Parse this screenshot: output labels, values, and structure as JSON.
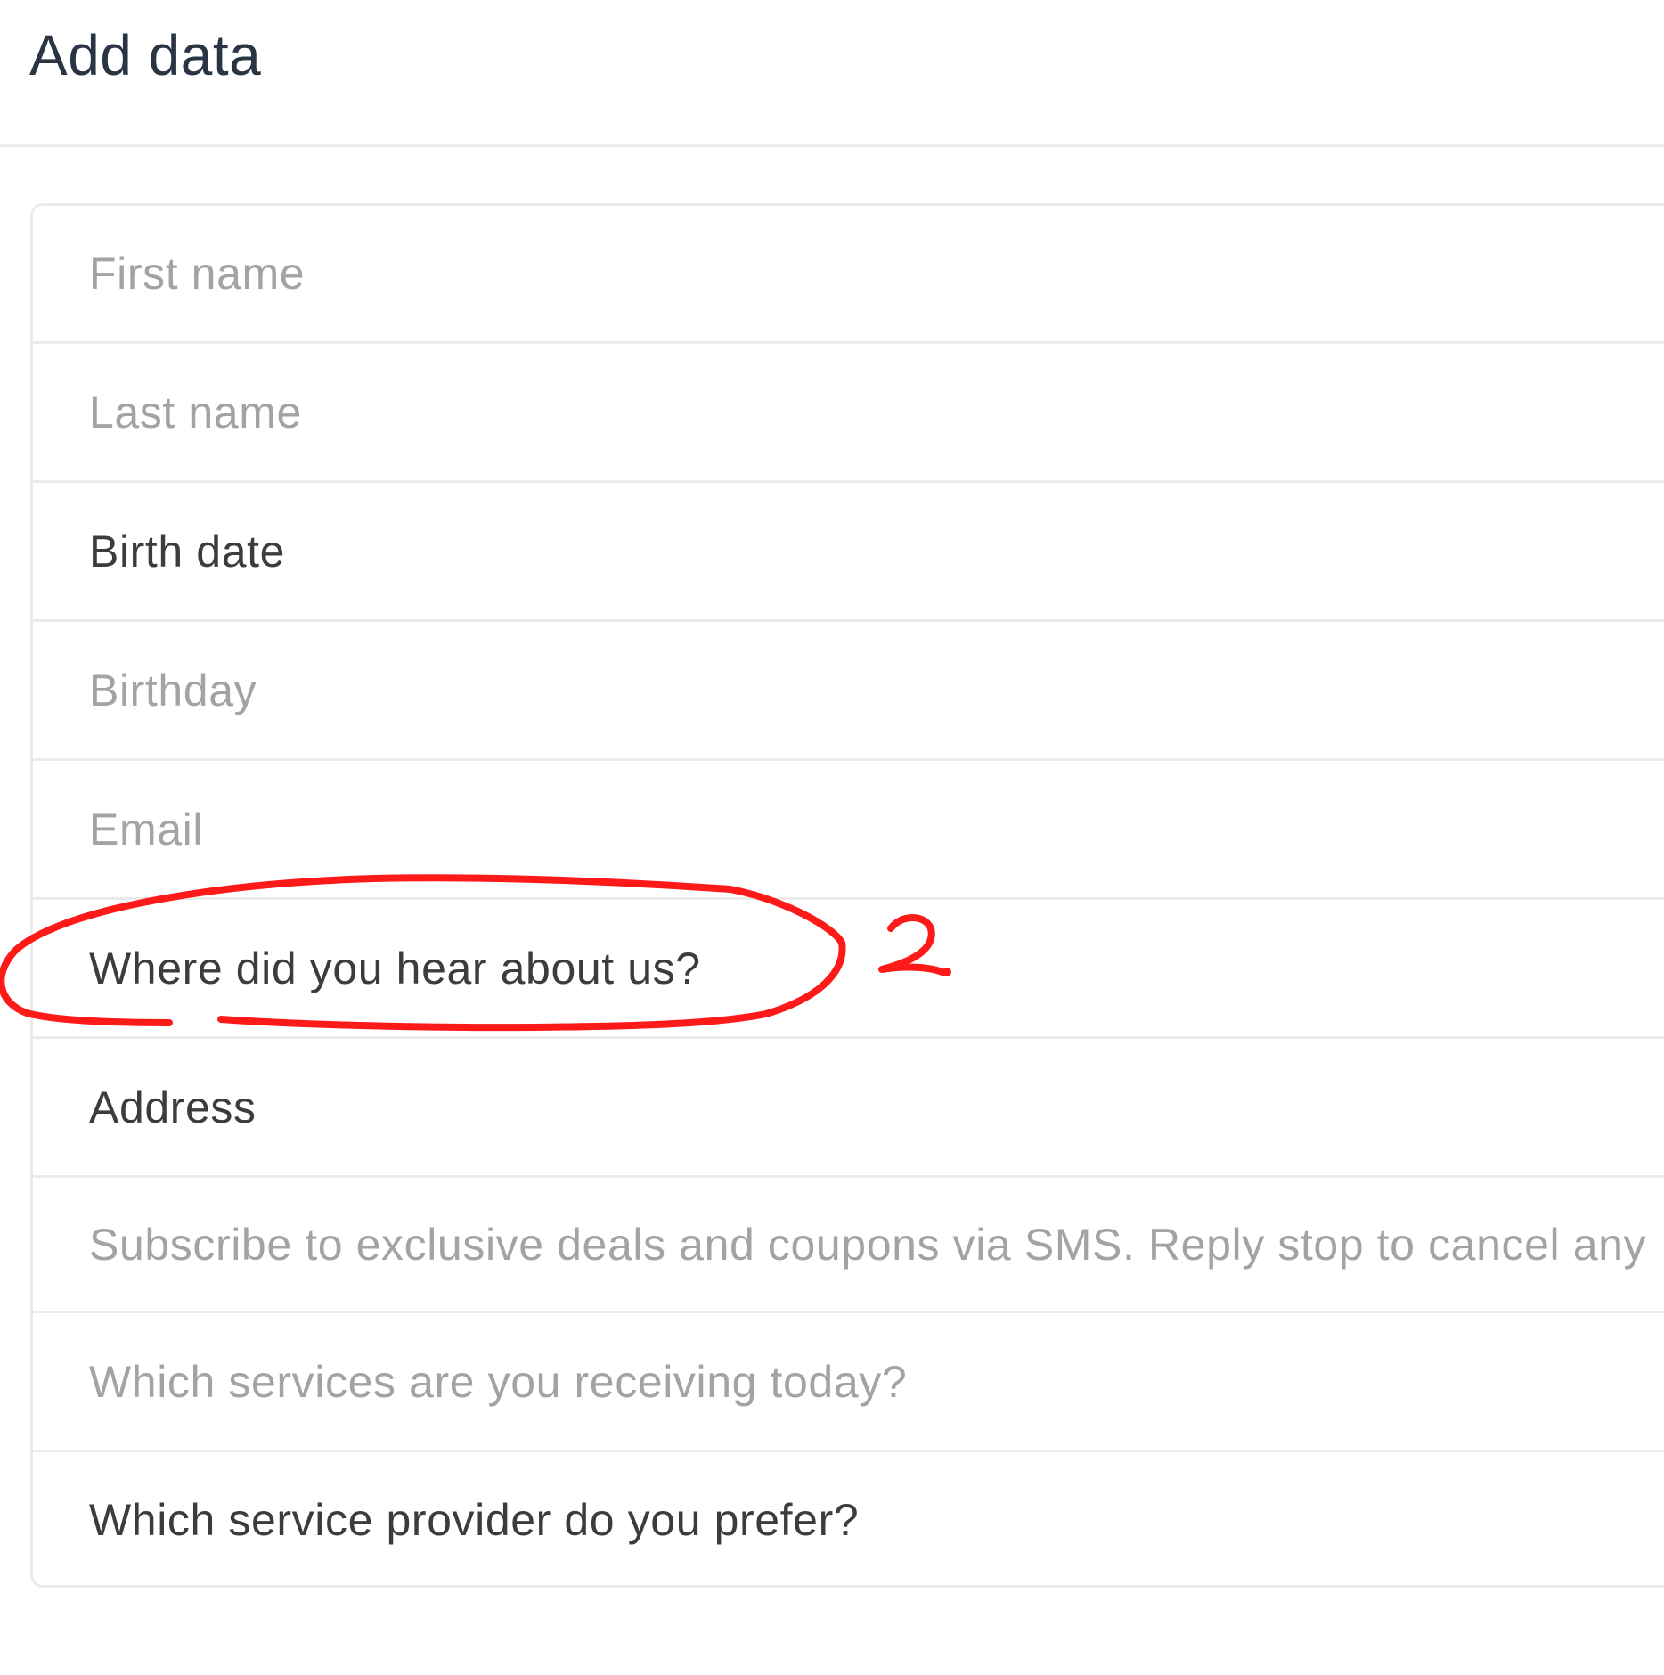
{
  "header": {
    "title": "Add data"
  },
  "fields": [
    {
      "label": "First name",
      "state": "placeholder"
    },
    {
      "label": "Last name",
      "state": "placeholder"
    },
    {
      "label": "Birth date",
      "state": "filled"
    },
    {
      "label": "Birthday",
      "state": "placeholder"
    },
    {
      "label": "Email",
      "state": "placeholder"
    },
    {
      "label": "Where did you hear about us?",
      "state": "filled"
    },
    {
      "label": "Address",
      "state": "filled"
    },
    {
      "label": "Subscribe to exclusive deals and coupons via SMS. Reply stop to cancel any",
      "state": "placeholder"
    },
    {
      "label": "Which services are you receiving today?",
      "state": "placeholder"
    },
    {
      "label": "Which service provider do you prefer?",
      "state": "filled"
    }
  ],
  "annotation": {
    "marker_label": "2.",
    "color": "#ff1a1a",
    "circled_field": "Where did you hear about us?"
  },
  "colors": {
    "title": "#2a3444",
    "placeholder_text": "#a3a3a3",
    "filled_text": "#3c3c3c",
    "divider": "#ebebeb"
  }
}
